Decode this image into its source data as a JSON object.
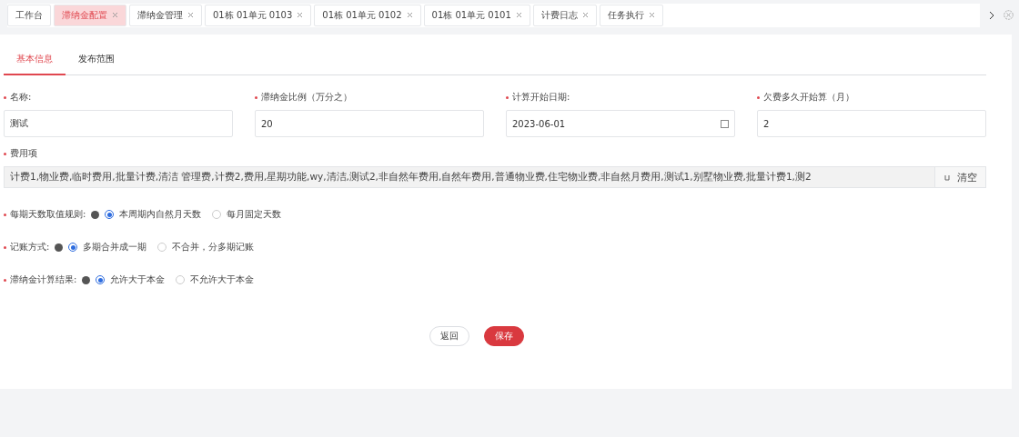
{
  "tabs": [
    {
      "label": "工作台",
      "selected": false,
      "closable": false
    },
    {
      "label": "滞纳金配置",
      "selected": true,
      "closable": true
    },
    {
      "label": "滞纳金管理",
      "selected": false,
      "closable": true
    },
    {
      "label": "01栋 01单元 0103",
      "selected": false,
      "closable": true
    },
    {
      "label": "01栋 01单元 0102",
      "selected": false,
      "closable": true
    },
    {
      "label": "01栋 01单元 0101",
      "selected": false,
      "closable": true
    },
    {
      "label": "计费日志",
      "selected": false,
      "closable": true
    },
    {
      "label": "任务执行",
      "selected": false,
      "closable": true
    }
  ],
  "sub_tabs": [
    {
      "label": "基本信息",
      "selected": true
    },
    {
      "label": "发布范围",
      "selected": false
    }
  ],
  "fields": [
    {
      "label": "名称:",
      "required": true,
      "value": "测试",
      "kind": "text"
    },
    {
      "label": "滞纳金比例（万分之）",
      "required": true,
      "value": "20",
      "kind": "text"
    },
    {
      "label": "计算开始日期:",
      "required": true,
      "value": "2023-06-01",
      "kind": "date"
    },
    {
      "label": "欠费多久开始算（月）",
      "required": true,
      "value": "2",
      "kind": "text"
    }
  ],
  "fee_items": {
    "label": "费用项",
    "required": true,
    "value": "计费1,物业费,临时费用,批量计费,清洁    管理费,计费2,费用,星期功能,wy,清洁,测试2,非自然年费用,自然年费用,普通物业费,住宅物业费,非自然月费用,测试1,别墅物业费,批量计费1,测2",
    "button": "清空"
  },
  "radio_groups": [
    {
      "label": "每期天数取值规则:",
      "required": true,
      "options": [
        {
          "label": "本周期内自然月天数",
          "selected": true
        },
        {
          "label": "每月固定天数",
          "selected": false
        }
      ]
    },
    {
      "label": "记账方式:",
      "required": true,
      "options": [
        {
          "label": "多期合并成一期",
          "selected": true
        },
        {
          "label": "不合并，分多期记账",
          "selected": false
        }
      ]
    },
    {
      "label": "滞纳金计算结果:",
      "required": true,
      "options": [
        {
          "label": "允许大于本金",
          "selected": true
        },
        {
          "label": "不允许大于本金",
          "selected": false
        }
      ]
    }
  ],
  "buttons": [
    {
      "label": "返回",
      "kind": "secondary"
    },
    {
      "label": "保存",
      "kind": "primary"
    }
  ]
}
